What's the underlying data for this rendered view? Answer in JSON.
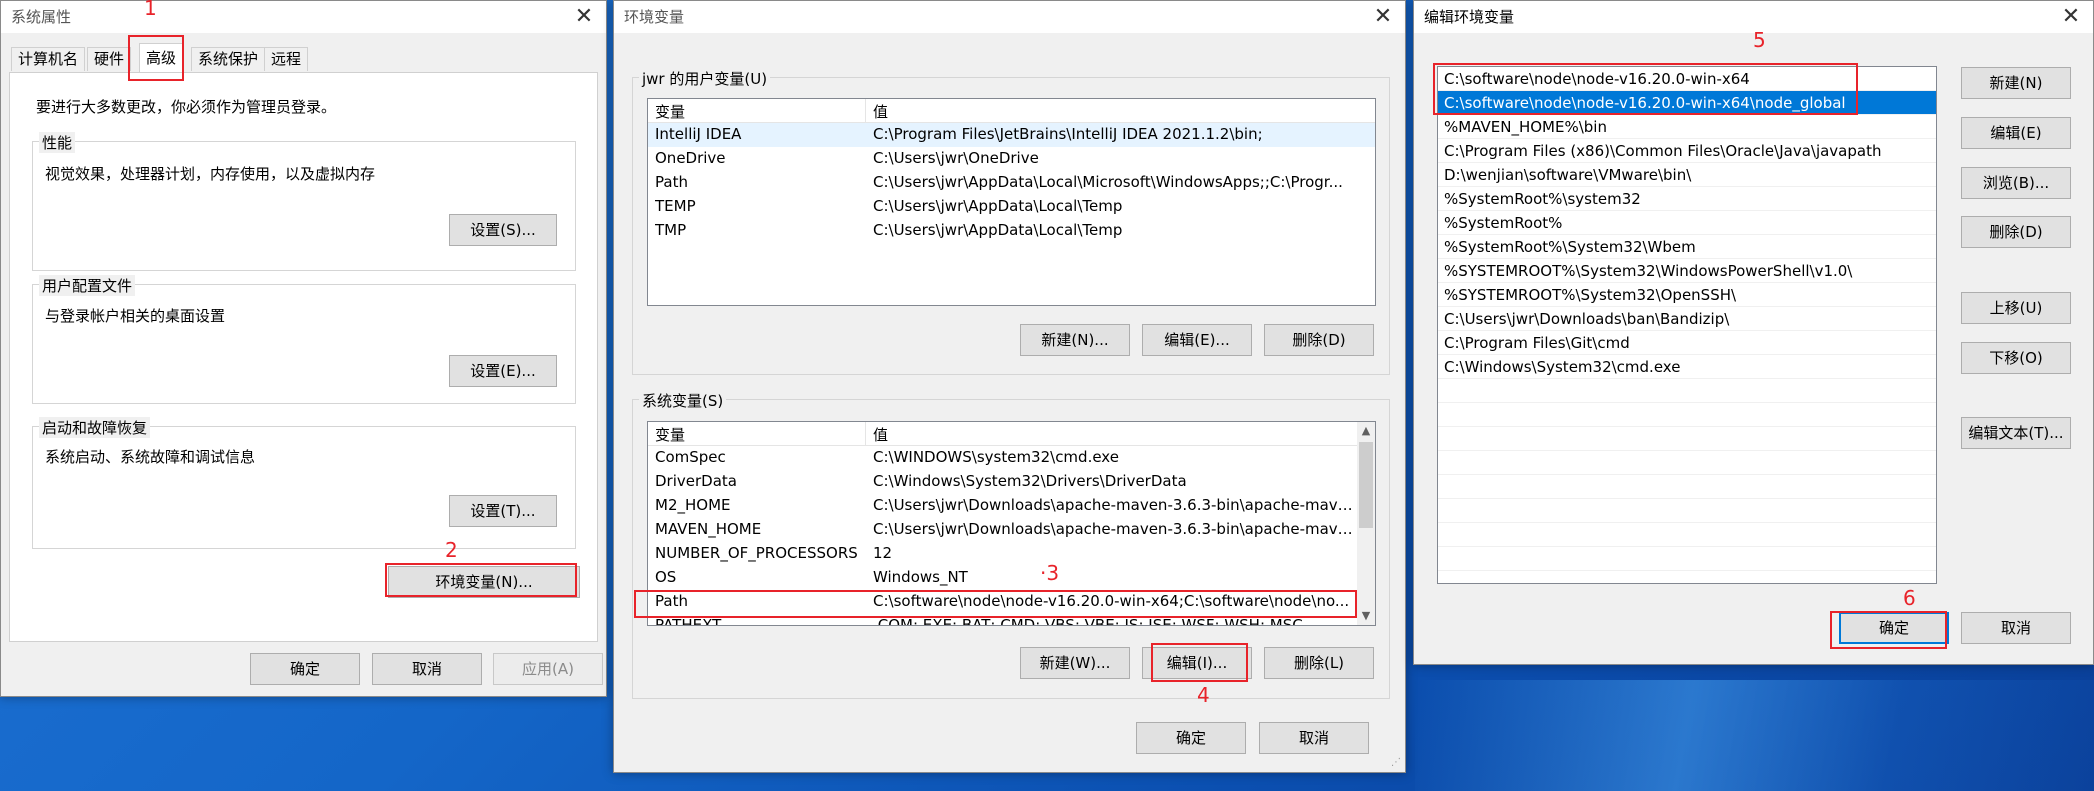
{
  "sysprops": {
    "title": "系统属性",
    "tabs": [
      "计算机名",
      "硬件",
      "高级",
      "系统保护",
      "远程"
    ],
    "admin_note": "要进行大多数更改，你必须作为管理员登录。",
    "perf": {
      "label": "性能",
      "desc": "视觉效果，处理器计划，内存使用，以及虚拟内存",
      "button": "设置(S)..."
    },
    "profile": {
      "label": "用户配置文件",
      "desc": "与登录帐户相关的桌面设置",
      "button": "设置(E)..."
    },
    "startup": {
      "label": "启动和故障恢复",
      "desc": "系统启动、系统故障和调试信息",
      "button": "设置(T)..."
    },
    "env_button": "环境变量(N)...",
    "ok": "确定",
    "cancel": "取消",
    "apply": "应用(A)"
  },
  "envvars": {
    "title": "环境变量",
    "user_group_label": "jwr 的用户变量(U)",
    "col_var": "变量",
    "col_val": "值",
    "user_vars": [
      {
        "name": "IntelliJ IDEA",
        "value": "C:\\Program Files\\JetBrains\\IntelliJ IDEA 2021.1.2\\bin;"
      },
      {
        "name": "OneDrive",
        "value": "C:\\Users\\jwr\\OneDrive"
      },
      {
        "name": "Path",
        "value": "C:\\Users\\jwr\\AppData\\Local\\Microsoft\\WindowsApps;;C:\\Progr..."
      },
      {
        "name": "TEMP",
        "value": "C:\\Users\\jwr\\AppData\\Local\\Temp"
      },
      {
        "name": "TMP",
        "value": "C:\\Users\\jwr\\AppData\\Local\\Temp"
      }
    ],
    "user_buttons": {
      "new": "新建(N)...",
      "edit": "编辑(E)...",
      "delete": "删除(D)"
    },
    "sys_group_label": "系统变量(S)",
    "sys_vars": [
      {
        "name": "ComSpec",
        "value": "C:\\WINDOWS\\system32\\cmd.exe"
      },
      {
        "name": "DriverData",
        "value": "C:\\Windows\\System32\\Drivers\\DriverData"
      },
      {
        "name": "M2_HOME",
        "value": "C:\\Users\\jwr\\Downloads\\apache-maven-3.6.3-bin\\apache-mave..."
      },
      {
        "name": "MAVEN_HOME",
        "value": "C:\\Users\\jwr\\Downloads\\apache-maven-3.6.3-bin\\apache-mave..."
      },
      {
        "name": "NUMBER_OF_PROCESSORS",
        "value": "12"
      },
      {
        "name": "OS",
        "value": "Windows_NT"
      },
      {
        "name": "Path",
        "value": "C:\\software\\node\\node-v16.20.0-win-x64;C:\\software\\node\\no..."
      },
      {
        "name": "PATHEXT",
        "value": ".COM;.EXE;.BAT;.CMD;.VBS;.VBE;.JS;.JSE;.WSF;.WSH;.MSC"
      }
    ],
    "sys_buttons": {
      "new": "新建(W)...",
      "edit": "编辑(I)...",
      "delete": "删除(L)"
    },
    "ok": "确定",
    "cancel": "取消"
  },
  "editenv": {
    "title": "编辑环境变量",
    "entries": [
      "C:\\software\\node\\node-v16.20.0-win-x64",
      "C:\\software\\node\\node-v16.20.0-win-x64\\node_global",
      "%MAVEN_HOME%\\bin",
      "C:\\Program Files (x86)\\Common Files\\Oracle\\Java\\javapath",
      "D:\\wenjian\\software\\VMware\\bin\\",
      "%SystemRoot%\\system32",
      "%SystemRoot%",
      "%SystemRoot%\\System32\\Wbem",
      "%SYSTEMROOT%\\System32\\WindowsPowerShell\\v1.0\\",
      "%SYSTEMROOT%\\System32\\OpenSSH\\",
      "C:\\Users\\jwr\\Downloads\\ban\\Bandizip\\",
      "C:\\Program Files\\Git\\cmd",
      "C:\\Windows\\System32\\cmd.exe"
    ],
    "buttons": {
      "new": "新建(N)",
      "edit": "编辑(E)",
      "browse": "浏览(B)...",
      "delete": "删除(D)",
      "up": "上移(U)",
      "down": "下移(O)",
      "edit_text": "编辑文本(T)..."
    },
    "ok": "确定",
    "cancel": "取消"
  },
  "annotations": {
    "step1": "1",
    "step2": "2",
    "step3": "·3",
    "step4": "4",
    "step5": "5",
    "step6": "6"
  },
  "colors": {
    "highlight": "#e8232a",
    "selection": "#0078d7",
    "desktop": "#1466c8"
  }
}
